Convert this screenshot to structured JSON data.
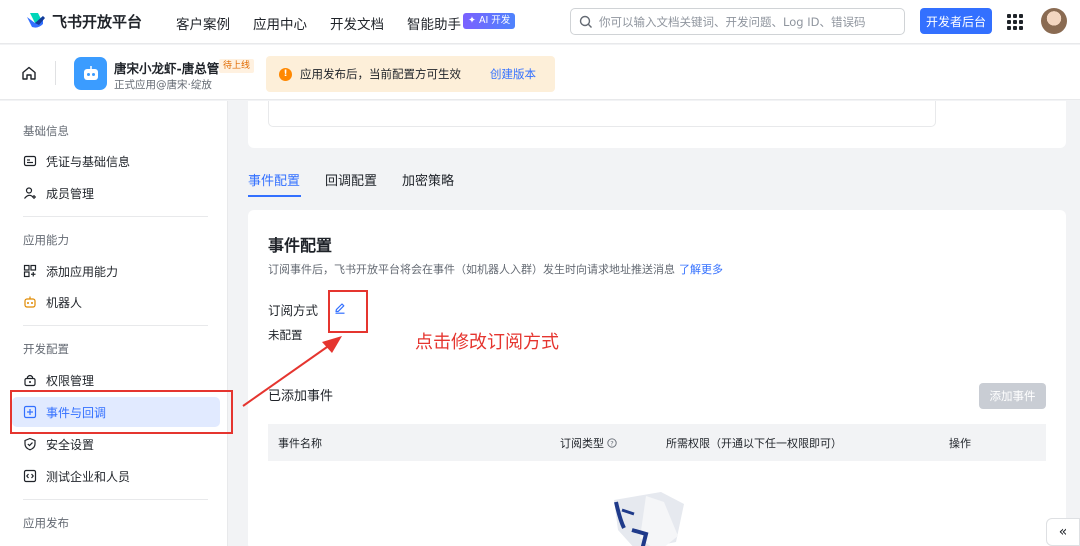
{
  "topnav": {
    "logo_text": "飞书开放平台",
    "items": [
      "客户案例",
      "应用中心",
      "开发文档",
      "智能助手"
    ],
    "ai_badge": "✦ AI 开发",
    "search_placeholder": "你可以输入文档关键词、开发问题、Log ID、错误码",
    "dev_button": "开发者后台"
  },
  "app": {
    "name": "唐宋小龙虾-唐总管",
    "status_badge": "待上线",
    "subtitle": "正式应用@唐宋·绽放",
    "notice": "应用发布后，当前配置方可生效",
    "notice_link": "创建版本"
  },
  "sidebar": {
    "sections": [
      {
        "title": "基础信息",
        "items": [
          "凭证与基础信息",
          "成员管理"
        ]
      },
      {
        "title": "应用能力",
        "items": [
          "添加应用能力",
          "机器人"
        ]
      },
      {
        "title": "开发配置",
        "items": [
          "权限管理",
          "事件与回调",
          "安全设置",
          "测试企业和人员"
        ]
      },
      {
        "title": "应用发布",
        "items": []
      }
    ]
  },
  "tabs": [
    "事件配置",
    "回调配置",
    "加密策略"
  ],
  "main": {
    "title": "事件配置",
    "desc": "订阅事件后，飞书开放平台将会在事件（如机器人入群）发生时向请求地址推送消息",
    "desc_link": "了解更多",
    "subscribe_label": "订阅方式",
    "subscribe_value": "未配置",
    "events_title": "已添加事件",
    "add_button": "添加事件",
    "columns": [
      "事件名称",
      "订阅类型",
      "所需权限（开通以下任一权限即可）",
      "操作"
    ]
  },
  "annotation": {
    "text": "点击修改订阅方式",
    "color": "#e5352f"
  },
  "colors": {
    "accent": "#3370ff",
    "active_bg": "#e1eaff"
  }
}
